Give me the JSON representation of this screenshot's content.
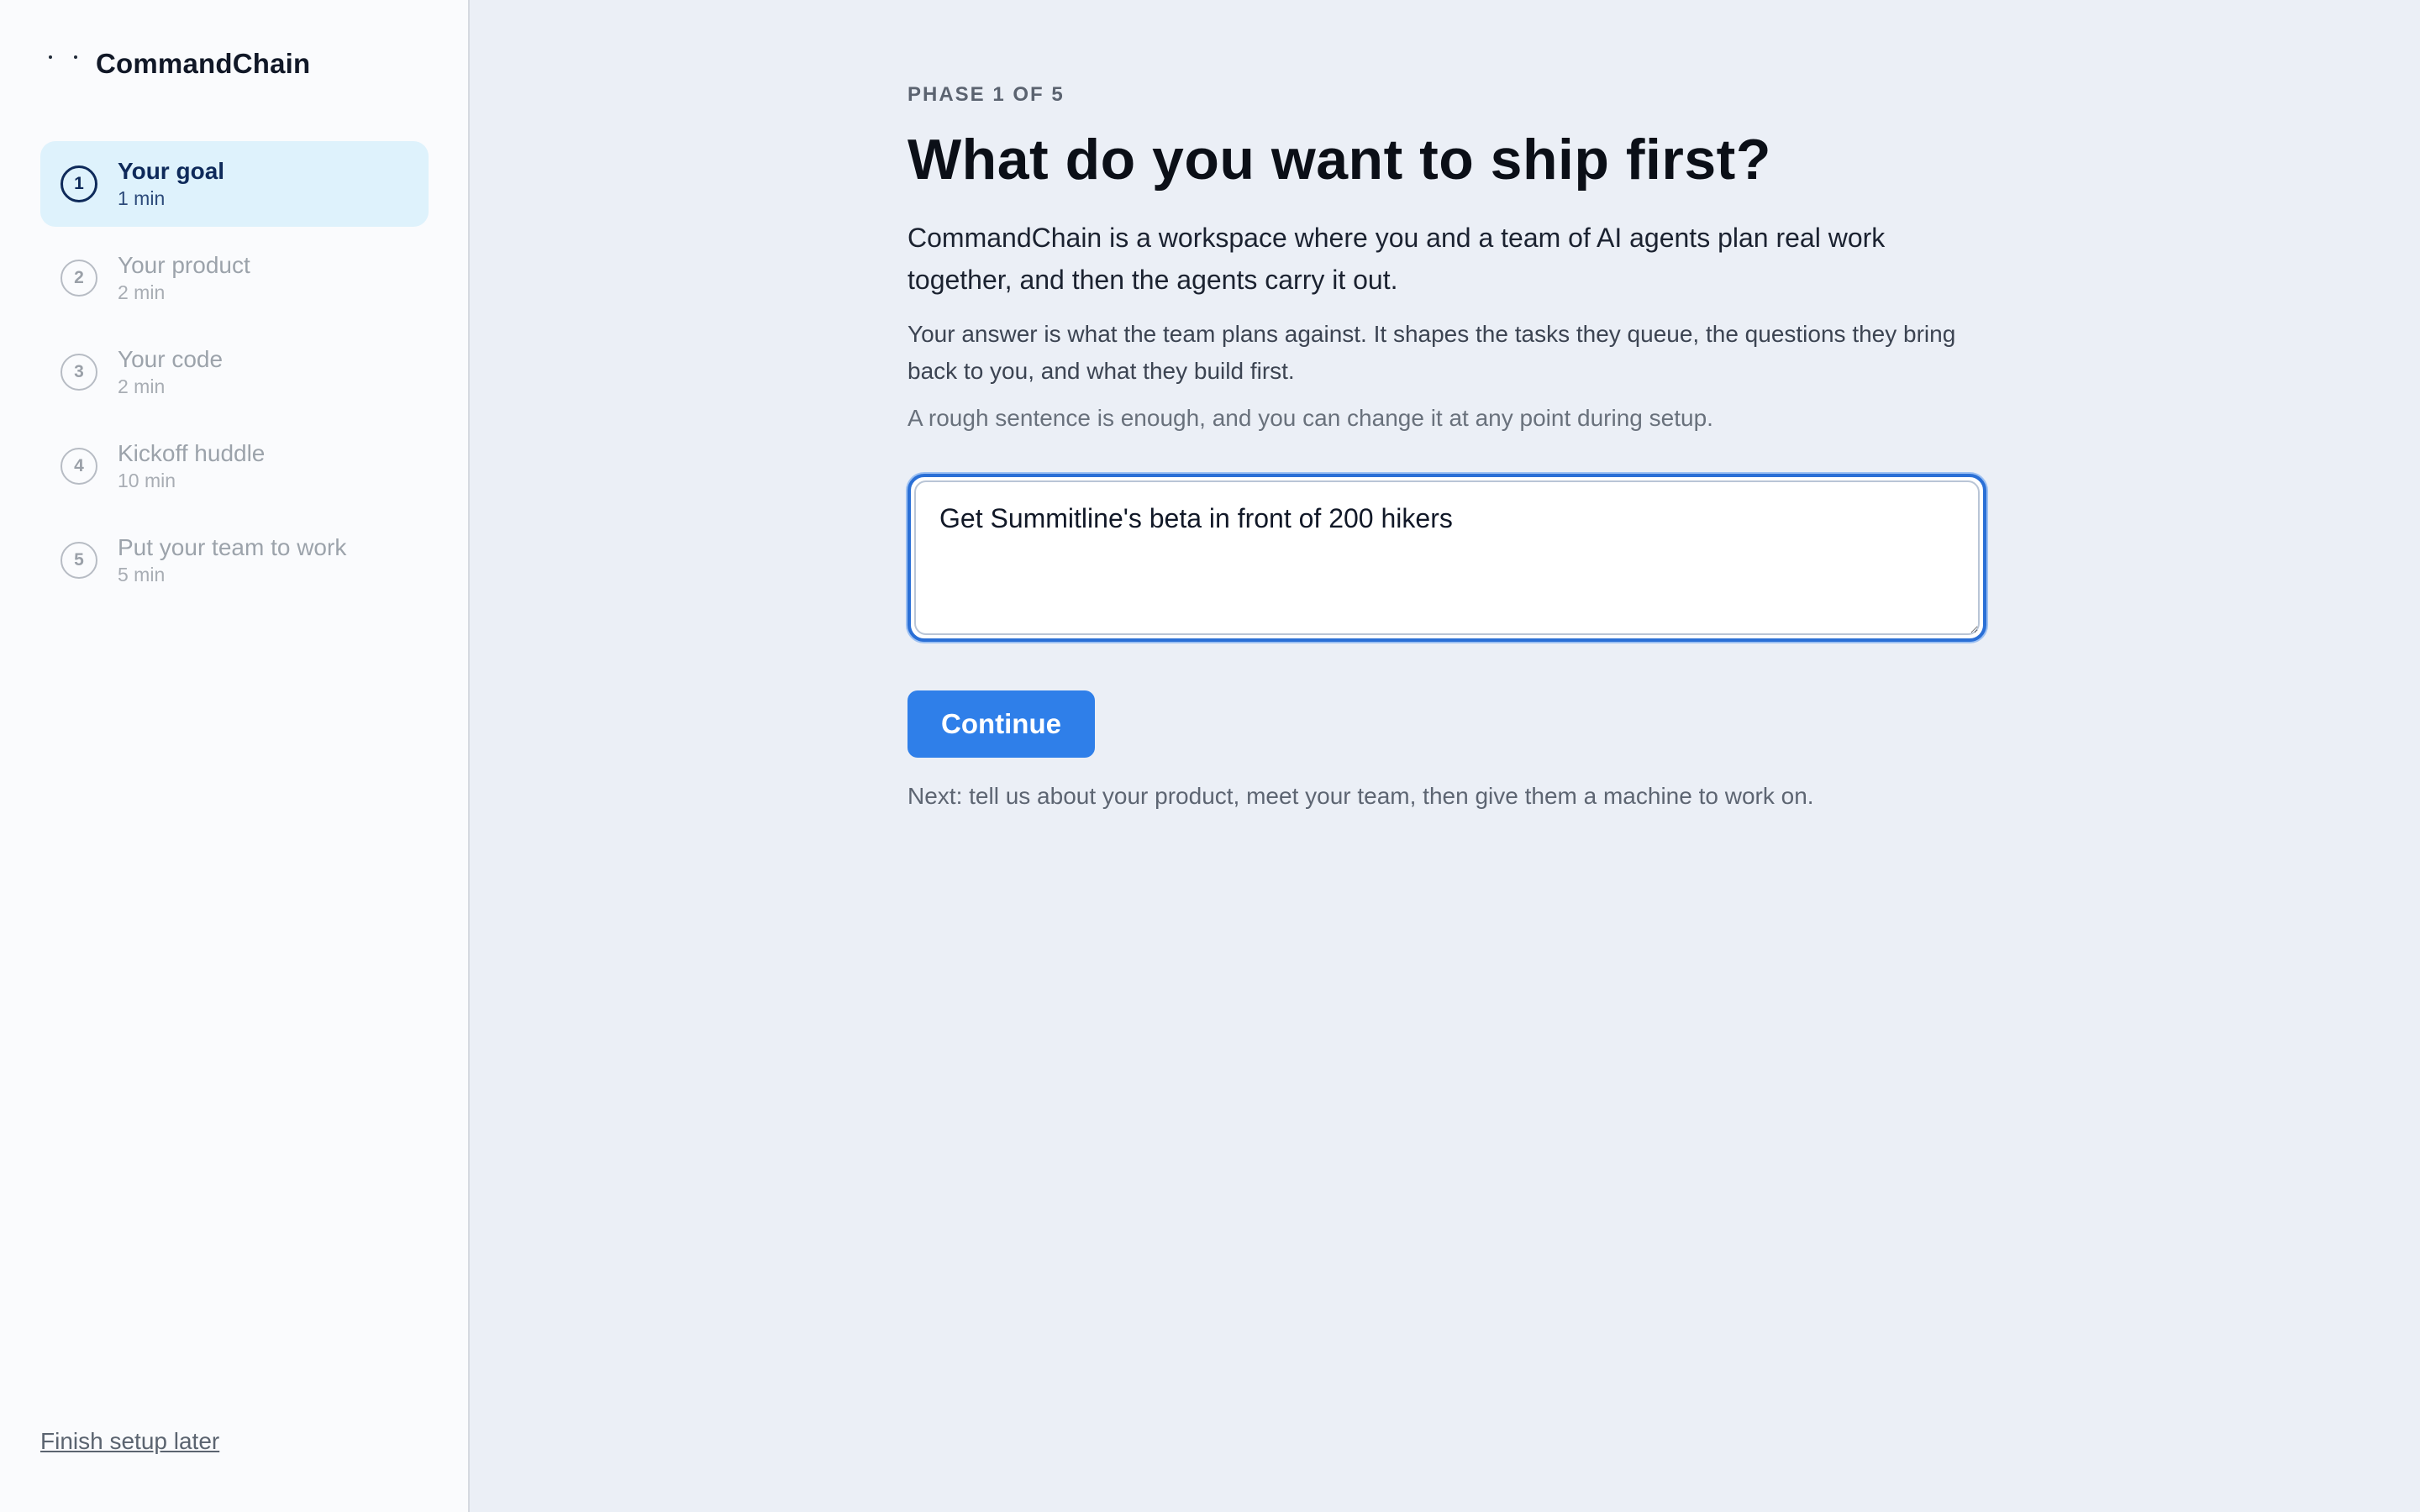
{
  "brand": {
    "name": "CommandChain",
    "logo_icon": "logo-dots-icon"
  },
  "sidebar": {
    "steps": [
      {
        "number": "1",
        "title": "Your goal",
        "time": "1 min",
        "state": "active"
      },
      {
        "number": "2",
        "title": "Your product",
        "time": "2 min",
        "state": "upcoming"
      },
      {
        "number": "3",
        "title": "Your code",
        "time": "2 min",
        "state": "upcoming"
      },
      {
        "number": "4",
        "title": "Kickoff huddle",
        "time": "10 min",
        "state": "upcoming"
      },
      {
        "number": "5",
        "title": "Put your team to work",
        "time": "5 min",
        "state": "upcoming"
      }
    ],
    "finish_later": "Finish setup later"
  },
  "main": {
    "phase": "PHASE 1 OF 5",
    "headline": "What do you want to ship first?",
    "lead": "CommandChain is a workspace where you and a team of AI agents plan real work together, and then the agents carry it out.",
    "body1": "Your answer is what the team plans against. It shapes the tasks they queue, the questions they bring back to you, and what they build first.",
    "body2": "A rough sentence is enough, and you can change it at any point during setup.",
    "goal_value": "Get Summitline's beta in front of 200 hikers",
    "continue_label": "Continue",
    "next_note": "Next: tell us about your product, meet your team, then give them a machine to work on."
  },
  "colors": {
    "accent": "#2f7fe9",
    "active_step_bg": "#def2fc",
    "active_step_text": "#0e2a5a",
    "page_bg": "#ebeff6",
    "sidebar_bg": "#fafbfd"
  }
}
